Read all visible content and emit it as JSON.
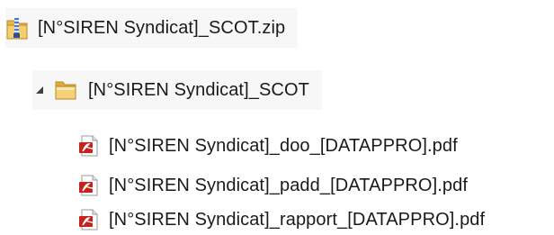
{
  "tree": {
    "archive": {
      "name": "[N°SIREN Syndicat]_SCOT.zip",
      "icon": "zip-folder-icon"
    },
    "folder": {
      "name": "[N°SIREN Syndicat]_SCOT",
      "icon": "folder-icon",
      "expander_icon": "expanded-triangle-icon",
      "expanded": true
    },
    "files": [
      {
        "name": "[N°SIREN Syndicat]_doo_[DATAPPRO].pdf",
        "icon": "pdf-file-icon"
      },
      {
        "name": "[N°SIREN Syndicat]_padd_[DATAPPRO].pdf",
        "icon": "pdf-file-icon"
      },
      {
        "name": "[N°SIREN Syndicat]_rapport_[DATAPPRO].pdf",
        "icon": "pdf-file-icon"
      }
    ]
  },
  "colors": {
    "folder": "#e8b84a",
    "zipper": "#4a78c8",
    "pdf_red": "#c8211d",
    "row_highlight": "#f7f7f7"
  }
}
